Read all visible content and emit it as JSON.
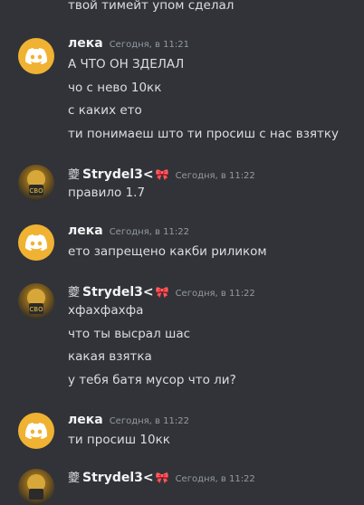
{
  "colors": {
    "background": "#313338",
    "username": "#f2f3f5",
    "timestamp": "#949ba4",
    "text": "#dbdee1",
    "discord_avatar": "#f0b232"
  },
  "top_line": "твой тимейт упом сделал",
  "groups": [
    {
      "user": "лека",
      "time": "Сегодня, в 11:21",
      "avatar_icon": "discord-logo-icon",
      "lines": [
        "А ЧТО ОН ЗДЕЛАЛ",
        "чо с нево 10кк",
        "с каких ето",
        "ти понимаеш што ти просиш с нас взятку"
      ]
    },
    {
      "user_prefix": "夔",
      "user": "Strydel3<",
      "user_suffix_icon": "ribbon-icon",
      "time": "Сегодня, в 11:22",
      "lines": [
        "правило 1.7"
      ]
    },
    {
      "user": "лека",
      "time": "Сегодня, в 11:22",
      "avatar_icon": "discord-logo-icon",
      "lines": [
        "ето запрещено какби риликом"
      ]
    },
    {
      "user_prefix": "夔",
      "user": "Strydel3<",
      "user_suffix_icon": "ribbon-icon",
      "time": "Сегодня, в 11:22",
      "lines": [
        "хфахфахфа",
        "что ты высрал шас",
        "какая взятка",
        "у тебя батя мусор что ли?"
      ]
    },
    {
      "user": "лека",
      "time": "Сегодня, в 11:22",
      "avatar_icon": "discord-logo-icon",
      "lines": [
        "ти просиш 10кк"
      ]
    },
    {
      "user_prefix": "夔",
      "user": "Strydel3<",
      "user_suffix_icon": "ribbon-icon",
      "time": "Сегодня, в 11:22",
      "lines": []
    }
  ]
}
